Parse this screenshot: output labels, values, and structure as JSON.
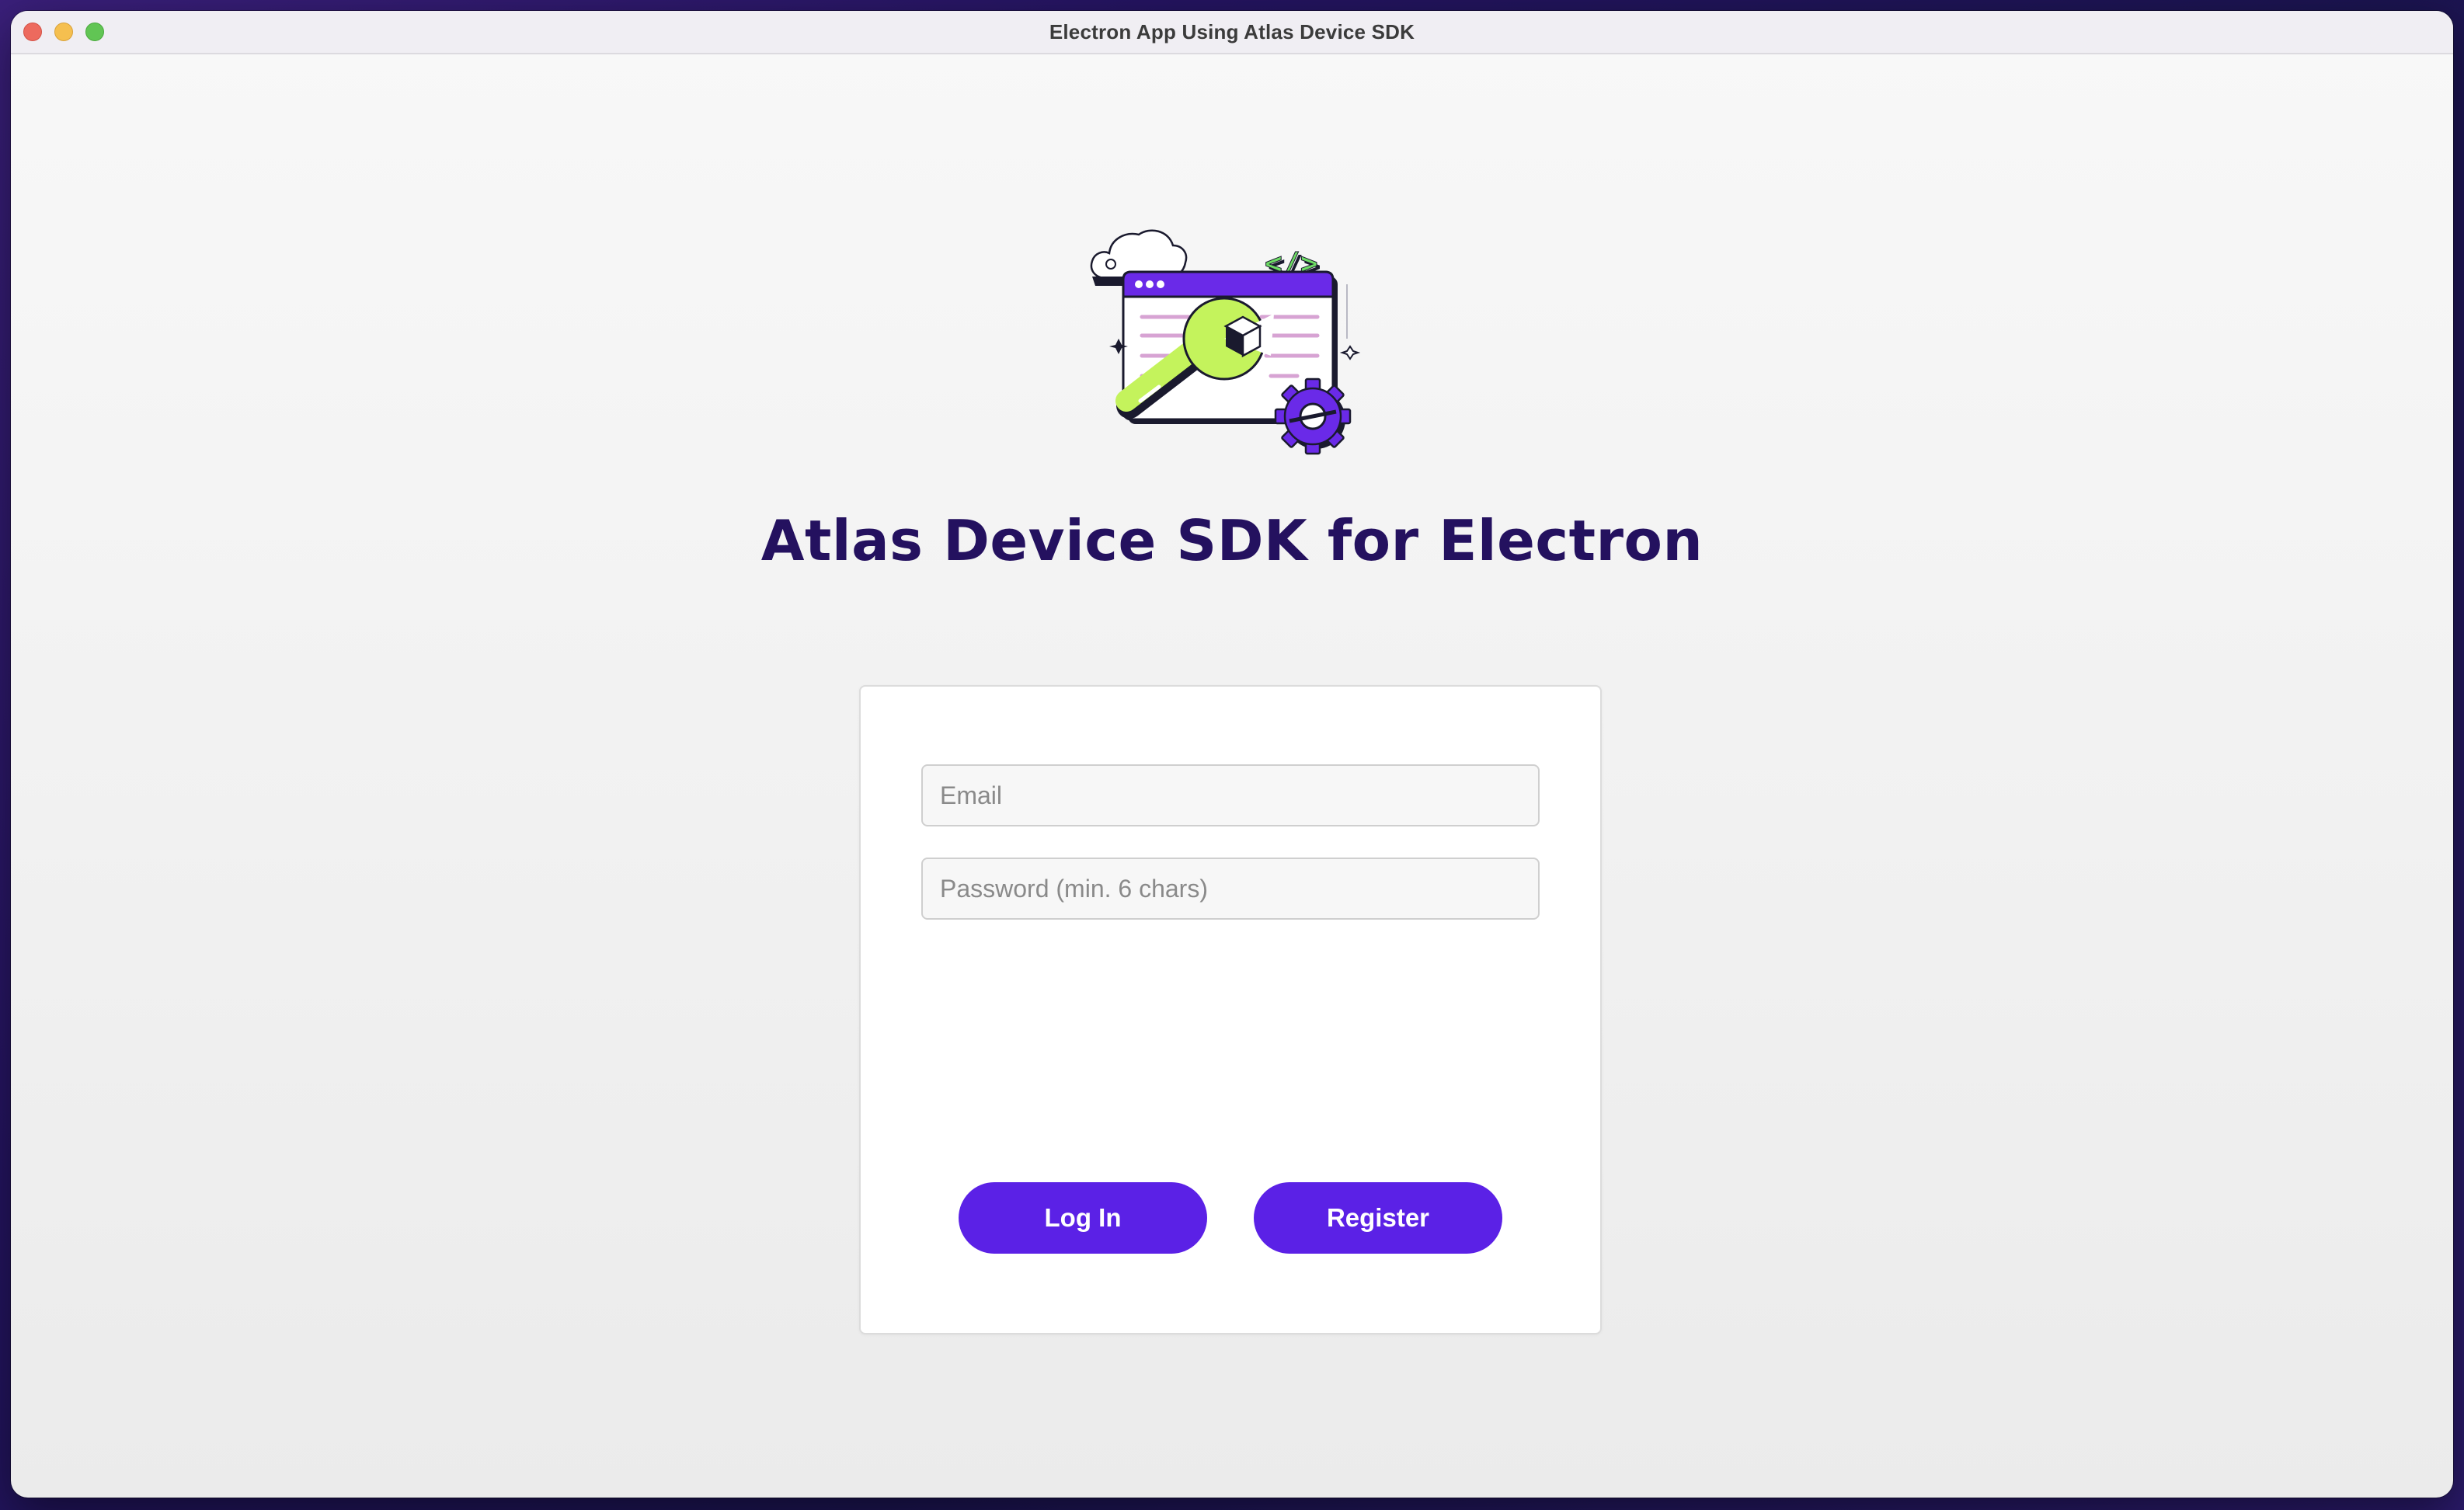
{
  "window": {
    "title": "Electron App Using Atlas Device SDK",
    "traffic_lights": [
      "close",
      "minimize",
      "maximize"
    ]
  },
  "hero": {
    "illustration": "browser-window-wrench-gear-illustration",
    "code_tag": "</>",
    "heading": "Atlas Device SDK for Electron"
  },
  "login_form": {
    "email_placeholder": "Email",
    "password_placeholder": "Password (min. 6 chars)",
    "login_label": "Log In",
    "register_label": "Register"
  },
  "colors": {
    "accent": "#5b21e6",
    "heading": "#24115f",
    "illustration_green": "#c4f35c",
    "illustration_purple": "#6a2ae8",
    "illustration_lines": "#d7a3d3"
  }
}
